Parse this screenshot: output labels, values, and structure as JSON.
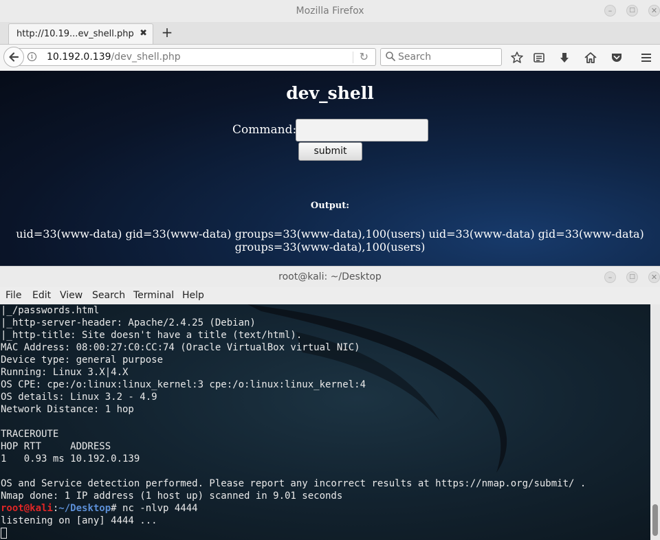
{
  "browser": {
    "window_title": "Mozilla Firefox",
    "tab_label": "http://10.19...ev_shell.php",
    "url_host": "10.192.0.139",
    "url_path": "/dev_shell.php",
    "search_placeholder": "Search"
  },
  "page": {
    "title": "dev_shell",
    "command_label": "Command:",
    "command_value": "",
    "submit_label": "submit",
    "output_label": "Output:",
    "output_text": "uid=33(www-data) gid=33(www-data) groups=33(www-data),100(users) uid=33(www-data) gid=33(www-data) groups=33(www-data),100(users)"
  },
  "terminal": {
    "window_title": "root@kali: ~/Desktop",
    "menu": [
      "File",
      "Edit",
      "View",
      "Search",
      "Terminal",
      "Help"
    ],
    "lines": [
      "|_/passwords.html",
      "|_http-server-header: Apache/2.4.25 (Debian)",
      "|_http-title: Site doesn't have a title (text/html).",
      "MAC Address: 08:00:27:C0:CC:74 (Oracle VirtualBox virtual NIC)",
      "Device type: general purpose",
      "Running: Linux 3.X|4.X",
      "OS CPE: cpe:/o:linux:linux_kernel:3 cpe:/o:linux:linux_kernel:4",
      "OS details: Linux 3.2 - 4.9",
      "Network Distance: 1 hop",
      "",
      "TRACEROUTE",
      "HOP RTT     ADDRESS",
      "1   0.93 ms 10.192.0.139",
      "",
      "OS and Service detection performed. Please report any incorrect results at https://nmap.org/submit/ .",
      "Nmap done: 1 IP address (1 host up) scanned in 9.01 seconds"
    ],
    "prompt_user": "root@kali",
    "prompt_sep": ":",
    "prompt_path": "~/Desktop",
    "prompt_symbol": "#",
    "command": " nc -nlvp 4444",
    "after_lines": [
      "listening on [any] 4444 ..."
    ]
  }
}
